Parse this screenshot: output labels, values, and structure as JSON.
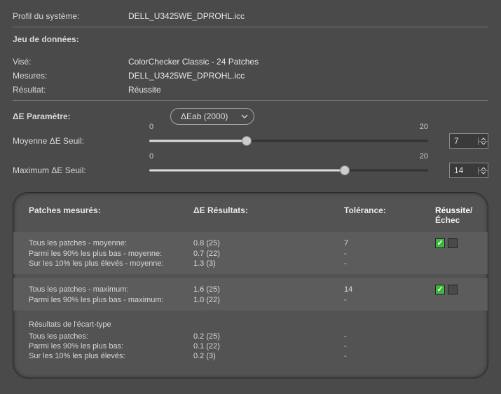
{
  "profile": {
    "label": "Profil du système:",
    "value": "DELL_U3425WE_DPROHL.icc"
  },
  "dataset": {
    "heading": "Jeu de données:",
    "vise_label": "Visé:",
    "vise_value": "ColorChecker Classic - 24 Patches",
    "mesures_label": "Mesures:",
    "mesures_value": "DELL_U3425WE_DPROHL.icc",
    "resultat_label": "Résultat:",
    "resultat_value": "Réussite"
  },
  "de_param": {
    "label": "ΔE Paramètre:",
    "selected": "ΔEab (2000)"
  },
  "threshold_avg": {
    "label": "Moyenne ΔE Seuil:",
    "min": "0",
    "max": "20",
    "value": "7",
    "fill_pct": 35
  },
  "threshold_max": {
    "label": "Maximum ΔE Seuil:",
    "min": "0",
    "max": "20",
    "value": "14",
    "fill_pct": 70
  },
  "results": {
    "head": {
      "c1": "Patches mesurés:",
      "c2": "ΔE Résultats:",
      "c3": "Tolérance:",
      "c4_pass": "Réussite",
      "c4_sep": "/",
      "c4_fail": "Échec"
    },
    "group1": {
      "rows": [
        {
          "label": "Tous les patches - moyenne:",
          "de": "0.8 (25)",
          "tol": "7"
        },
        {
          "label": "Parmi les 90% les plus bas - moyenne:",
          "de": "0.7 (22)",
          "tol": "-"
        },
        {
          "label": "Sur les 10% les plus élevés - moyenne:",
          "de": "1.3 (3)",
          "tol": "-"
        }
      ]
    },
    "group2": {
      "rows": [
        {
          "label": "Tous les patches - maximum:",
          "de": "1.6 (25)",
          "tol": "14"
        },
        {
          "label": "Parmi les 90% les plus bas - maximum:",
          "de": "1.0 (22)",
          "tol": "-"
        }
      ]
    },
    "group3": {
      "title": "Résultats de l'écart-type",
      "rows": [
        {
          "label": "Tous les patches:",
          "de": "0.2 (25)",
          "tol": "-"
        },
        {
          "label": "Parmi les 90% les plus bas:",
          "de": "0.1 (22)",
          "tol": "-"
        },
        {
          "label": "Sur les 10% les plus élevés:",
          "de": "0.2 (3)",
          "tol": "-"
        }
      ]
    }
  }
}
